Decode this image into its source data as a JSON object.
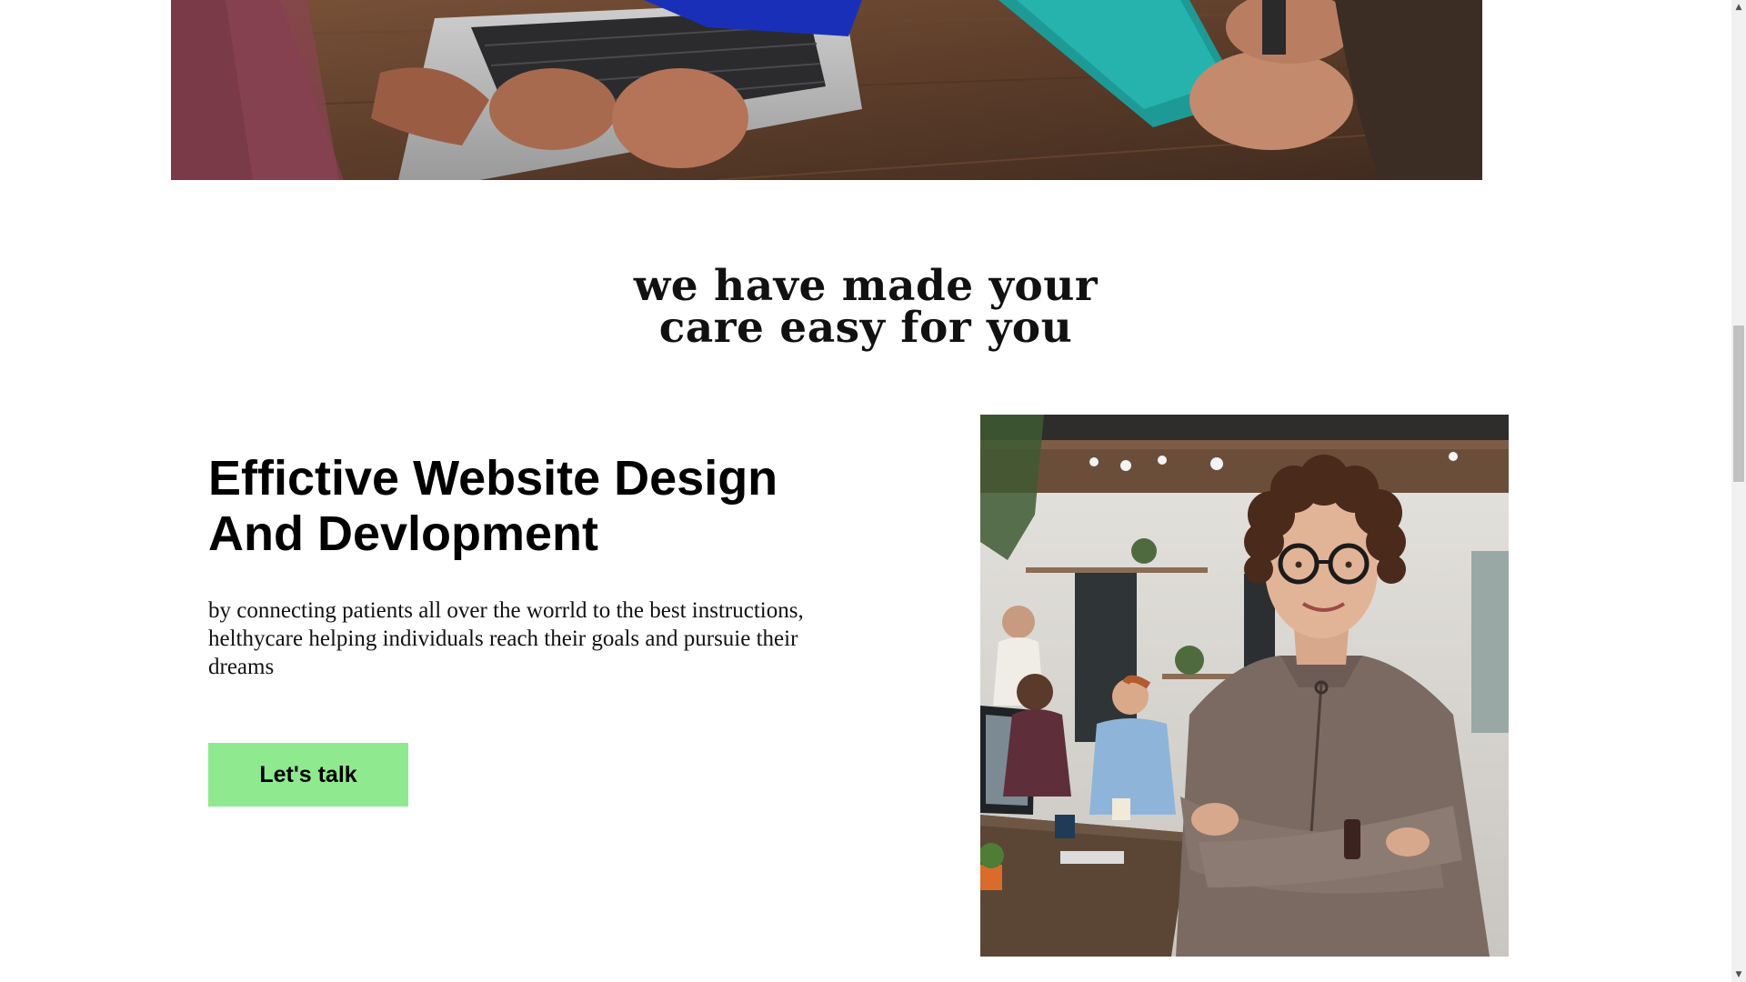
{
  "section": {
    "heading_line1": "we have made your",
    "heading_line2": "care easy for you"
  },
  "feature": {
    "title_line1": "Effictive Website Design",
    "title_line2": "And Devlopment",
    "description": "by connecting patients all over the worrld to the best instructions, helthycare helping individuals reach their goals and pursuie their dreams",
    "cta_label": "Let's talk"
  },
  "images": {
    "hero": "photo-of-people-working-on-laptop-at-wooden-table",
    "portrait": "photo-of-smiling-woman-with-glasses-arms-crossed-in-office"
  },
  "scrollbar": {
    "up_icon": "▲",
    "down_icon": "▼"
  },
  "colors": {
    "cta_background": "#8fea8f",
    "text": "#000000",
    "background": "#ffffff"
  }
}
